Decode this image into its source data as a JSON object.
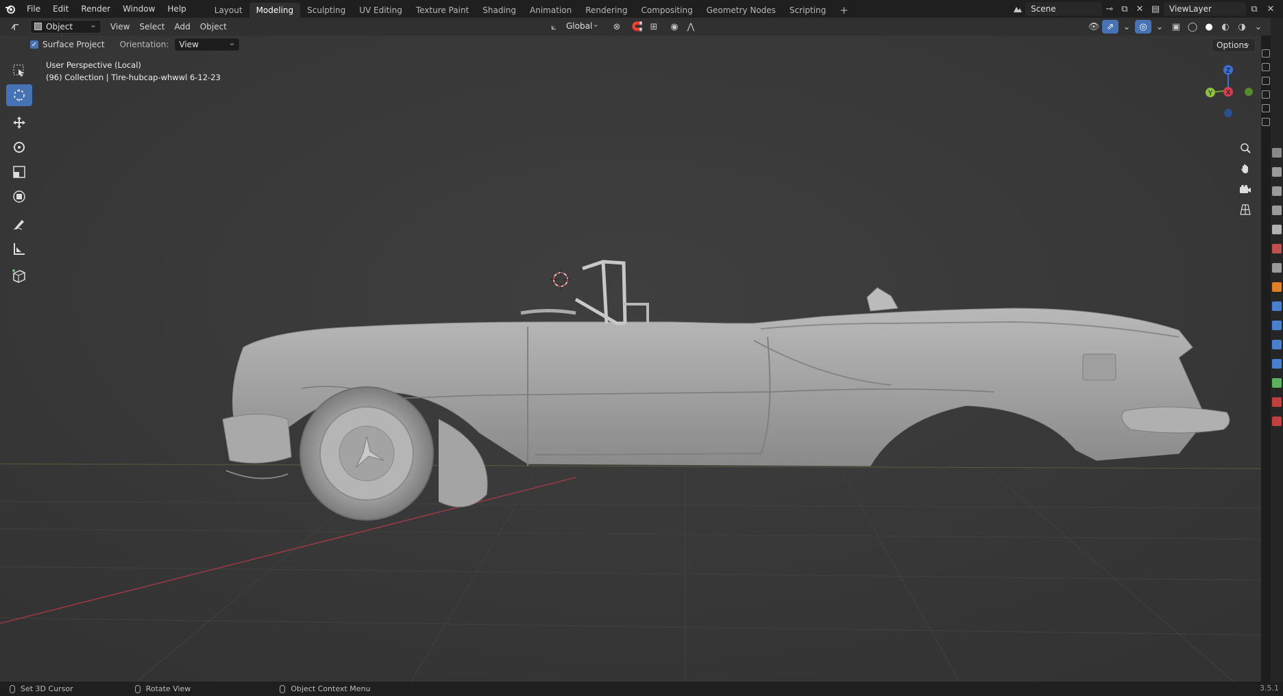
{
  "topbar": {
    "logo_icon": "blender-logo-icon",
    "menus": [
      "File",
      "Edit",
      "Render",
      "Window",
      "Help"
    ],
    "workspaces": [
      "Layout",
      "Modeling",
      "Sculpting",
      "UV Editing",
      "Texture Paint",
      "Shading",
      "Animation",
      "Rendering",
      "Compositing",
      "Geometry Nodes",
      "Scripting"
    ],
    "active_workspace": "Modeling",
    "add_workspace": "+",
    "scene_name": "Scene",
    "view_layer": "ViewLayer"
  },
  "header": {
    "mode": "Object Mode",
    "menus": [
      "View",
      "Select",
      "Add",
      "Object"
    ],
    "transform_orientation": "Global",
    "options_label": "Options"
  },
  "tool_settings": {
    "surface_project_label": "Surface Project",
    "surface_project_checked": true,
    "orientation_label": "Orientation:",
    "orientation_value": "View"
  },
  "viewport": {
    "perspective_label": "User Perspective (Local)",
    "collection_label": "(96) Collection | Tire-hubcap-whwwl  6-12-23",
    "gizmo_axes": [
      "Z",
      "Y",
      "X"
    ]
  },
  "toolbar": {
    "tools": [
      "select-box-icon",
      "cursor-icon",
      "move-icon",
      "rotate-icon",
      "scale-icon",
      "transform-icon",
      "annotate-icon",
      "measure-icon",
      "add-cube-icon"
    ],
    "active_tool": "cursor-icon"
  },
  "statusbar": {
    "items": [
      "Set 3D Cursor",
      "Rotate View",
      "Object Context Menu"
    ],
    "version": "3.5.1"
  },
  "colors": {
    "accent": "#4772b3",
    "viewport_bg": "#393939",
    "axis_x": "#d04050",
    "axis_y": "#70a030",
    "axis_z": "#3a70d0"
  }
}
